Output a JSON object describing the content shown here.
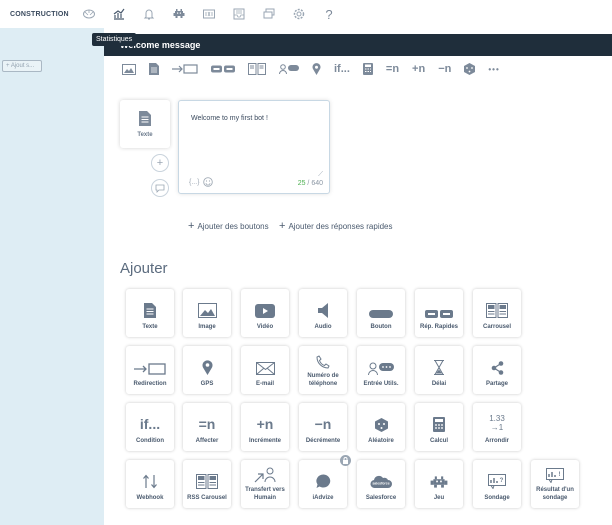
{
  "topbar": {
    "brand_label": "CONSTRUCTION"
  },
  "tooltip": {
    "text": "Statistiques"
  },
  "sidebar": {
    "add_label": "+ Ajout s..."
  },
  "header": {
    "title": "Welcome message"
  },
  "toolbar": {
    "if_label": "if...",
    "eq_label": "=n",
    "plus_label": "+n",
    "minus_label": "−n",
    "more_label": "•••"
  },
  "message": {
    "card_label": "Texte",
    "text": "Welcome to my first bot !",
    "vars_label": "{...}",
    "count": "25",
    "max": " / 640"
  },
  "links": {
    "add_buttons": "Ajouter des boutons",
    "add_quick": "Ajouter des réponses rapides",
    "plus": "+"
  },
  "ajouter": {
    "title": "Ajouter",
    "tiles": [
      {
        "label": "Texte"
      },
      {
        "label": "Image"
      },
      {
        "label": "Vidéo"
      },
      {
        "label": "Audio"
      },
      {
        "label": "Bouton"
      },
      {
        "label": "Rép. Rapides"
      },
      {
        "label": "Carrousel"
      },
      {
        "label": "Redirection"
      },
      {
        "label": "GPS"
      },
      {
        "label": "E-mail"
      },
      {
        "label": "Numéro de téléphone"
      },
      {
        "label": "Entrée Utils."
      },
      {
        "label": "Délai"
      },
      {
        "label": "Partage"
      },
      {
        "label": "Condition",
        "glyph": "if..."
      },
      {
        "label": "Affecter",
        "glyph": "=n"
      },
      {
        "label": "Incrémente",
        "glyph": "+n"
      },
      {
        "label": "Décrémente",
        "glyph": "−n"
      },
      {
        "label": "Aléatoire"
      },
      {
        "label": "Calcul"
      },
      {
        "label": "Arrondir",
        "glyph": "1.33",
        "glyph2": "→1"
      },
      {
        "label": "Webhook"
      },
      {
        "label": "RSS Carousel"
      },
      {
        "label": "Transfert vers Humain"
      },
      {
        "label": "iAdvize"
      },
      {
        "label": "Salesforce"
      },
      {
        "label": "Jeu"
      },
      {
        "label": "Sondage"
      },
      {
        "label": "Résultat d'un sondage"
      }
    ]
  }
}
